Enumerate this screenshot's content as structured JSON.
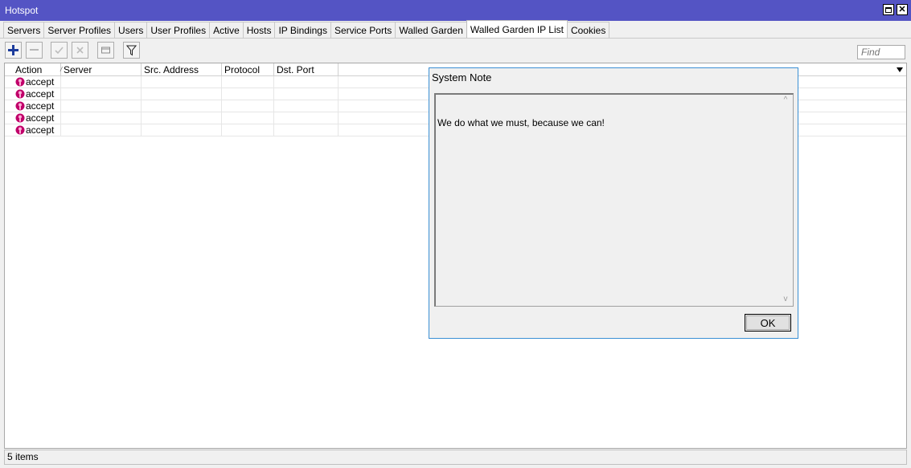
{
  "window": {
    "title": "Hotspot"
  },
  "tabs": [
    {
      "label": "Servers"
    },
    {
      "label": "Server Profiles"
    },
    {
      "label": "Users"
    },
    {
      "label": "User Profiles"
    },
    {
      "label": "Active"
    },
    {
      "label": "Hosts"
    },
    {
      "label": "IP Bindings"
    },
    {
      "label": "Service Ports"
    },
    {
      "label": "Walled Garden"
    },
    {
      "label": "Walled Garden IP List",
      "active": true
    },
    {
      "label": "Cookies"
    }
  ],
  "toolbar": {
    "add": "plus-icon",
    "remove": "minus-icon",
    "enable": "check-icon",
    "disable": "x-icon",
    "comment": "note-icon",
    "filter": "filter-icon"
  },
  "search": {
    "placeholder": "Find"
  },
  "table": {
    "columns": [
      {
        "label": "Action",
        "sort": "/"
      },
      {
        "label": "Server"
      },
      {
        "label": "Src. Address"
      },
      {
        "label": "Protocol"
      },
      {
        "label": "Dst. Port"
      }
    ],
    "rows": [
      {
        "action": "accept",
        "server": "",
        "src": "",
        "protocol": "",
        "dst_port": ""
      },
      {
        "action": "accept",
        "server": "",
        "src": "",
        "protocol": "",
        "dst_port": ""
      },
      {
        "action": "accept",
        "server": "",
        "src": "",
        "protocol": "",
        "dst_port": ""
      },
      {
        "action": "accept",
        "server": "",
        "src": "",
        "protocol": "",
        "dst_port": ""
      },
      {
        "action": "accept",
        "server": "",
        "src": "",
        "protocol": "",
        "dst_port": ""
      }
    ]
  },
  "status": {
    "count": "5 items"
  },
  "dialog": {
    "title": "System Note",
    "message": "We do what we must, because we can!",
    "ok_label": "OK"
  },
  "colors": {
    "titlebar": "#5454c4",
    "accent_add": "#1c3c9c",
    "accept_icon": "#c0006a",
    "dialog_border": "#3a8fd4"
  }
}
